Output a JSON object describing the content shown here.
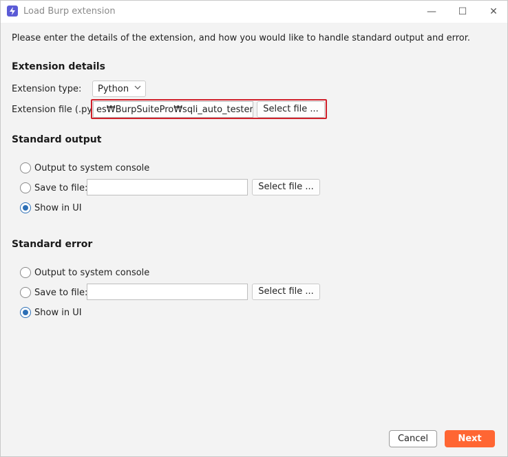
{
  "window": {
    "title": "Load Burp extension",
    "controls": {
      "minimize": "—",
      "maximize": "☐",
      "close": "✕"
    }
  },
  "intro": "Please enter the details of the extension, and how you would like to handle standard output and error.",
  "extension_details": {
    "heading": "Extension details",
    "type_label": "Extension type:",
    "type_value": "Python",
    "file_label": "Extension file (.py):",
    "file_value": "es₩BurpSuitePro₩sqli_auto_tester.py",
    "select_file": "Select file ..."
  },
  "standard_output": {
    "heading": "Standard output",
    "opt_console": "Output to system console",
    "opt_save": "Save to file:",
    "save_path": "",
    "select_file": "Select file ...",
    "opt_ui": "Show in UI",
    "selected": "Show in UI"
  },
  "standard_error": {
    "heading": "Standard error",
    "opt_console": "Output to system console",
    "opt_save": "Save to file:",
    "save_path": "",
    "select_file": "Select file ...",
    "opt_ui": "Show in UI",
    "selected": "Show in UI"
  },
  "footer": {
    "cancel": "Cancel",
    "next": "Next"
  },
  "colors": {
    "accent": "#ff6633",
    "highlight": "#d0202a",
    "radio": "#2c6fb6"
  }
}
